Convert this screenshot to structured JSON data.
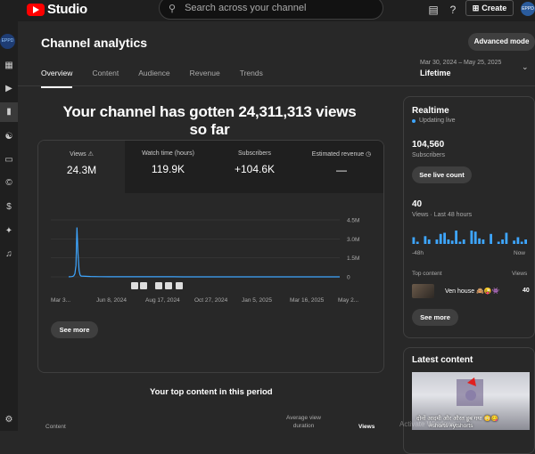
{
  "topbar": {
    "logo_text": "Studio",
    "search_placeholder": "Search across your channel",
    "create_label": "Create",
    "avatar_text": "EPPD"
  },
  "sidebar": {
    "avatar_text": "EPPD"
  },
  "header": {
    "title": "Channel analytics",
    "advanced_mode_label": "Advanced mode",
    "tabs": [
      "Overview",
      "Content",
      "Audience",
      "Revenue",
      "Trends"
    ],
    "active_tab": "Overview",
    "date_range": "Mar 30, 2024 – May 25, 2025",
    "period": "Lifetime"
  },
  "overview": {
    "headline": "Your channel has gotten 24,311,313 views so far",
    "metrics": [
      {
        "label": "Views",
        "value": "24.3M"
      },
      {
        "label": "Watch time (hours)",
        "value": "119.9K"
      },
      {
        "label": "Subscribers",
        "value": "+104.6K"
      },
      {
        "label": "Estimated revenue",
        "value": "—"
      }
    ],
    "see_more_label": "See more"
  },
  "chart_data": {
    "type": "line",
    "x_ticks": [
      "Mar 3...",
      "Jun 8, 2024",
      "Aug 17, 2024",
      "Oct 27, 2024",
      "Jan 5, 2025",
      "Mar 16, 2025",
      "May 2..."
    ],
    "y_ticks": [
      "4.5M",
      "3.0M",
      "1.5M",
      "0"
    ],
    "ylim": [
      0,
      4500000
    ],
    "series": [
      {
        "values": [
          10000,
          10000,
          15000,
          20000,
          40000,
          90000,
          250000,
          900000,
          3900000,
          1800000,
          500000,
          150000,
          60000,
          25000,
          15000,
          10000,
          8000,
          6000,
          5000,
          5000,
          4000,
          4000,
          4000,
          3000,
          3000,
          3000,
          3000,
          3000,
          3000,
          3000,
          3000,
          3000,
          3000,
          3000,
          3000,
          3000,
          3000,
          3000,
          3000,
          3000,
          3000
        ]
      }
    ],
    "color": "#3ea6ff",
    "grid": true
  },
  "top_content": {
    "title": "Your top content in this period",
    "col_content": "Content",
    "col_avg": "Average view duration",
    "col_views": "Views"
  },
  "realtime": {
    "title": "Realtime",
    "updating": "Updating live",
    "subscribers_value": "104,560",
    "subscribers_label": "Subscribers",
    "live_count_label": "See live count",
    "views_value": "40",
    "views_label": "Views · Last 48 hours",
    "axis_left": "-48h",
    "axis_right": "Now",
    "bars": [
      0.3,
      0.1,
      0,
      0.35,
      0.2,
      0,
      0.2,
      0.45,
      0.5,
      0.2,
      0.15,
      0.6,
      0.1,
      0.2,
      0,
      0.6,
      0.55,
      0.25,
      0.2,
      0,
      0.45,
      0,
      0.1,
      0.2,
      0.5,
      0,
      0.15,
      0.3,
      0.1,
      0.2
    ],
    "top_content_label": "Top content",
    "views_col_label": "Views",
    "top_item_title": "Ven house 🙈😜👾",
    "top_item_views": "40",
    "see_more_label": "See more",
    "accent": "#3ea6ff"
  },
  "latest": {
    "title": "Latest content",
    "caption": "दोनों आदमी और औरत डूब गया 😳😋",
    "tags": "#shorts #ytshorts"
  },
  "watermark": "Activate Windows"
}
